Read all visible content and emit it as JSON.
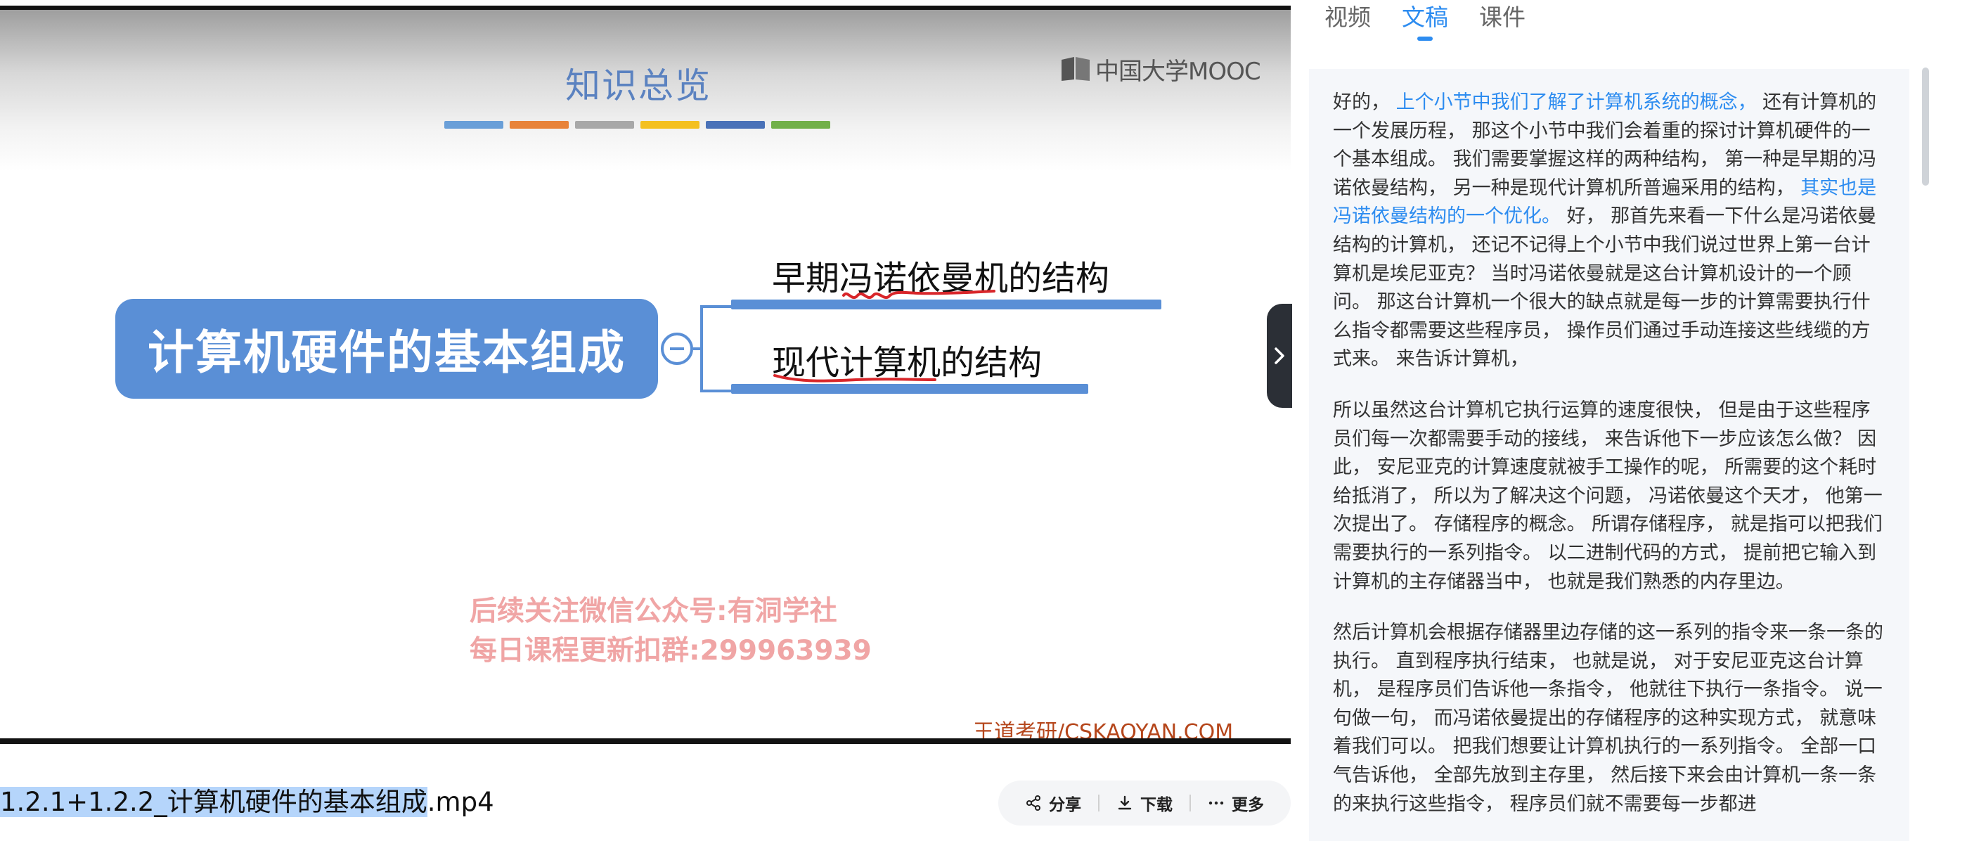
{
  "slide": {
    "title": "知识总览",
    "logo_text": "中国大学MOOC",
    "color_bar": [
      "#6a9fd8",
      "#e8833a",
      "#a8a8a8",
      "#f4c020",
      "#4a72b8",
      "#72b04a"
    ],
    "root_node": "计算机硬件的基本组成",
    "branches": [
      {
        "label": "早期冯诺依曼机的结构"
      },
      {
        "label": "现代计算机的结构"
      }
    ],
    "watermark_line1": "后续关注微信公众号:有洞学社",
    "watermark_line2": "每日课程更新扣群:299963939",
    "credit": "王道考研/CSKAOYAN.COM"
  },
  "video": {
    "filename_selected": "1.2.1+1.2.2_计算机硬件的基本组成",
    "filename_rest": ".mp4",
    "actions": {
      "share": "分享",
      "download": "下载",
      "more": "更多"
    }
  },
  "tabs": [
    {
      "label": "视频",
      "active": false
    },
    {
      "label": "文稿",
      "active": true
    },
    {
      "label": "课件",
      "active": false
    }
  ],
  "transcript": {
    "p1": [
      {
        "text": "好的， ",
        "hl": false
      },
      {
        "text": "上个小节中我们了解了计算机系统的概念，",
        "hl": true
      },
      {
        "text": " 还有计算机的一个发展历程， 那这个小节中我们会着重的探讨计算机硬件的一个基本组成。 我们需要掌握这样的两种结构， 第一种是早期的冯诺依曼结构， 另一种是现代计算机所普遍采用的结构，",
        "hl": false
      },
      {
        "text": " 其实也是冯诺依曼结构的一个优化。",
        "hl": true
      },
      {
        "text": " 好， 那首先来看一下什么是冯诺依曼结构的计算机， 还记不记得上个小节中我们说过世界上第一台计算机是埃尼亚克？ 当时冯诺依曼就是这台计算机设计的一个顾问。 那这台计算机一个很大的缺点就是每一步的计算需要执行什么指令都需要这些程序员， 操作员们通过手动连接这些线缆的方式来。 来告诉计算机，",
        "hl": false
      }
    ],
    "p2": "所以虽然这台计算机它执行运算的速度很快， 但是由于这些程序员们每一次都需要手动的接线， 来告诉他下一步应该怎么做？ 因此， 安尼亚克的计算速度就被手工操作的呢， 所需要的这个耗时给抵消了， 所以为了解决这个问题， 冯诺依曼这个天才， 他第一次提出了。 存储程序的概念。 所谓存储程序， 就是指可以把我们需要执行的一系列指令。 以二进制代码的方式， 提前把它输入到计算机的主存储器当中， 也就是我们熟悉的内存里边。",
    "p3": "然后计算机会根据存储器里边存储的这一系列的指令来一条一条的执行。 直到程序执行结束， 也就是说， 对于安尼亚克这台计算机， 是程序员们告诉他一条指令， 他就往下执行一条指令。 说一句做一句， 而冯诺依曼提出的存储程序的这种实现方式， 就意味着我们可以。 把我们想要让计算机执行的一系列指令。 全部一口气告诉他， 全部先放到主存里， 然后接下来会由计算机一条一条的来执行这些指令， 程序员们就不需要每一步都进"
  }
}
